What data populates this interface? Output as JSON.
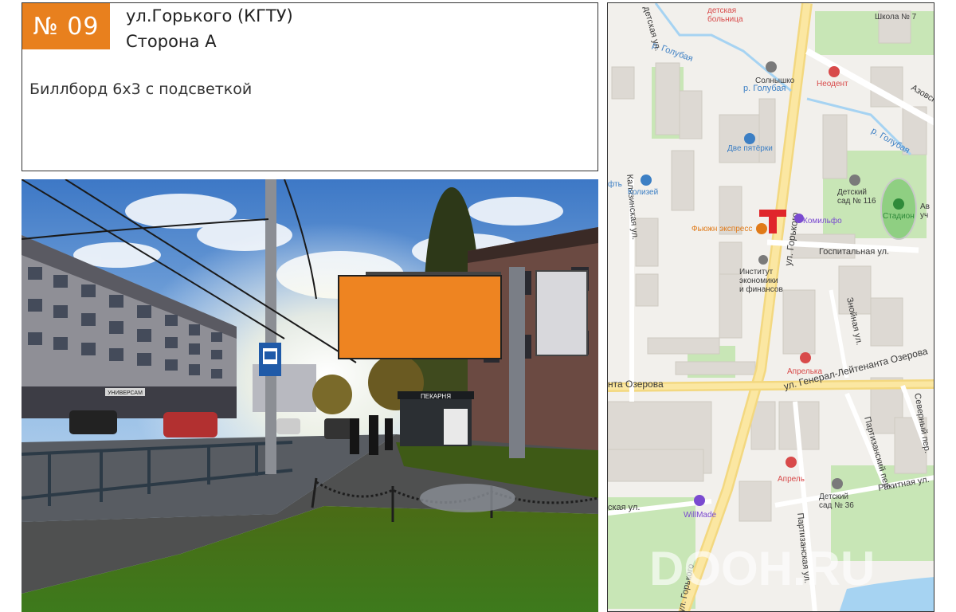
{
  "header": {
    "badge": "№ 09",
    "title_line1": "ул.Горького (КГТУ)",
    "title_line2": "Сторона А",
    "description": "Биллборд 6х3 с подсветкой"
  },
  "photo": {
    "storefront_sign": "ПЕКАРНЯ",
    "shop_sign": "УНИВЕРСАМ",
    "billboard_color": "#ee8421"
  },
  "map": {
    "streets": {
      "gorkogo_main": "ул. Горького",
      "gorkogo_south": "ул. Горького",
      "ozerova_west": "нта Озерова",
      "ozerova_east": "ул. Генерал-Лейтенанта Озерова",
      "gospitalnaya": "Госпитальная ул.",
      "kalyazinskaya": "Калязинская ул.",
      "azovskaya": "Азовск",
      "golubaya_1": "р. Голубая",
      "golubaya_2": "р. Голубая",
      "golubaya_3": "р. Голубая",
      "partizansky": "Партизанский пер.",
      "partizanskaya": "Партизанская ул.",
      "znoyny": "Знойная ул.",
      "severny": "Северный пер.",
      "rakitnaya": "Ракитная ул.",
      "skaya": "ская ул.",
      "detskaya_top": "детская ул."
    },
    "pois": {
      "bolnitsa": "детская\nбольница",
      "shkola": "Школа № 7",
      "solnyshko": "Солнышко",
      "neodent": "Неодент",
      "dve_pyaterki": "Две пятёрки",
      "kolizey": "Колизей",
      "detsad116": "Детский\nсад № 116",
      "stadion": "Стадион",
      "komilfo": "Комильфо",
      "fusion": "Фьюжн экспресс",
      "institut": "Институт\nэкономики\nи финансов",
      "aprelka": "Апрелька",
      "aprel": "Апрель",
      "detsad36": "Детский\nсад № 36",
      "willmade": "WillMade",
      "aftb": "фть",
      "avu": "Ав\nуч"
    },
    "watermark": "DOOH.RU",
    "marker_color": "#e0262b"
  }
}
